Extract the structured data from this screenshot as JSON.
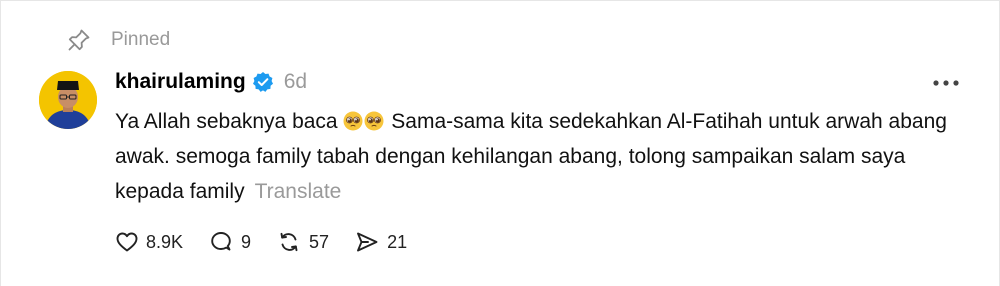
{
  "pinned": {
    "label": "Pinned",
    "icon": "pin-icon"
  },
  "post": {
    "username": "khairulaming",
    "verified_icon": "verified-badge-icon",
    "time": "6d",
    "text_before_emoji": "Ya Allah sebaknya baca ",
    "emoji": [
      "pleading-face-emoji",
      "pleading-face-emoji"
    ],
    "text_after_emoji": " Sama-sama kita sedekahkan Al-Fatihah untuk arwah abang awak. semoga family tabah dengan kehilangan abang, tolong sampaikan salam saya kepada family",
    "translate_label": "Translate",
    "more_icon": "more-options-icon"
  },
  "actions": {
    "like": {
      "icon": "heart-icon",
      "count": "8.9K"
    },
    "reply": {
      "icon": "reply-bubble-icon",
      "count": "9"
    },
    "repost": {
      "icon": "repost-icon",
      "count": "57"
    },
    "share": {
      "icon": "send-icon",
      "count": "21"
    }
  },
  "colors": {
    "muted": "#999999",
    "verified": "#1d9bf0",
    "avatar_bg": "#f4c400"
  }
}
